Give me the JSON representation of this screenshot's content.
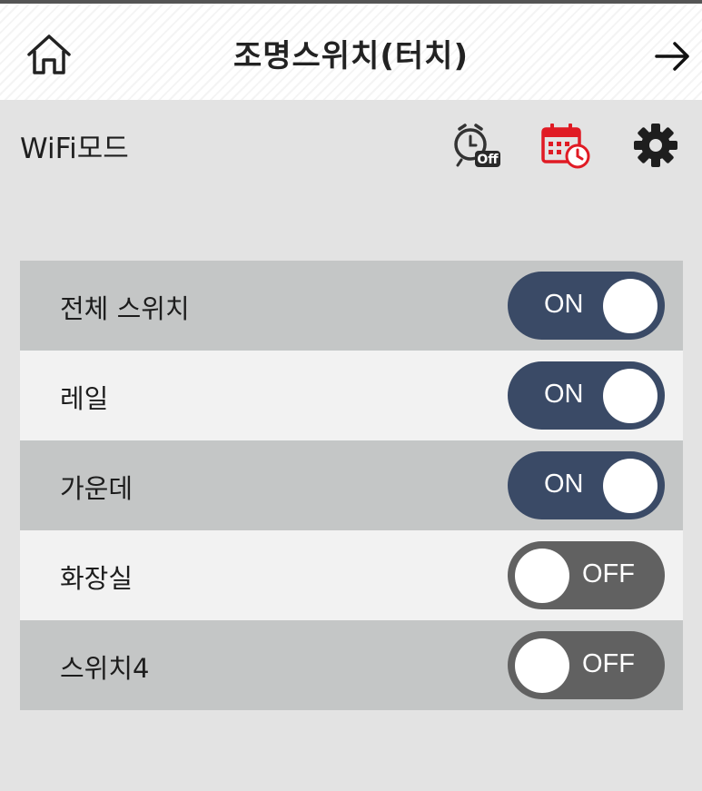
{
  "header": {
    "title": "조명스위치(터치)"
  },
  "modebar": {
    "mode_label": "WiFi모드",
    "timer_badge": "Off"
  },
  "switches": [
    {
      "label": "전체 스위치",
      "state": "ON"
    },
    {
      "label": "레일",
      "state": "ON"
    },
    {
      "label": "가운데",
      "state": "ON"
    },
    {
      "label": "화장실",
      "state": "OFF"
    },
    {
      "label": "스위치4",
      "state": "OFF"
    }
  ],
  "colors": {
    "toggle_on": "#3a4a66",
    "toggle_off": "#616161",
    "calendar_icon": "#e01b24"
  }
}
